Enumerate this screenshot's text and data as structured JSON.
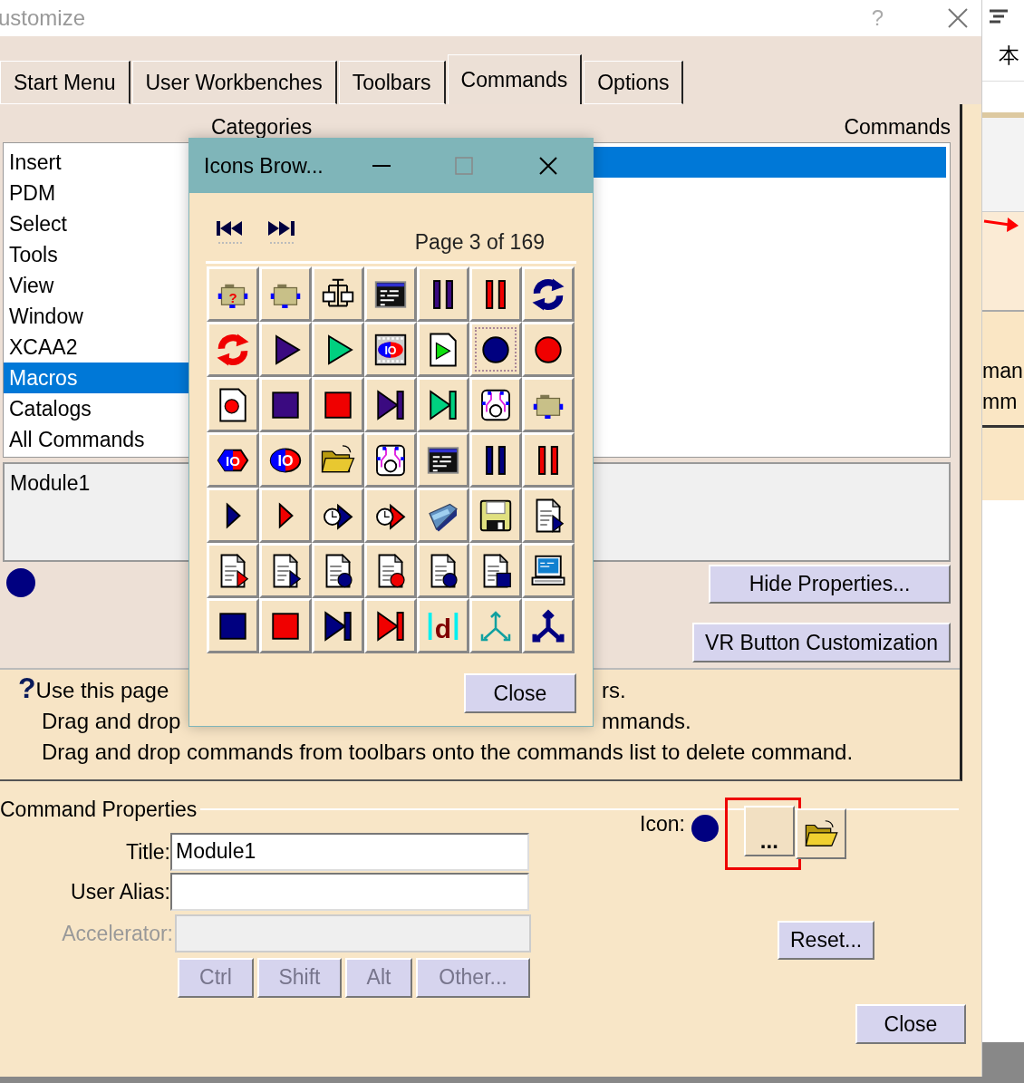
{
  "window": {
    "title": "ustomize",
    "help_button": "?"
  },
  "tabs": [
    {
      "label": "Start Menu",
      "selected": false
    },
    {
      "label": "User Workbenches",
      "selected": false
    },
    {
      "label": "Toolbars",
      "selected": false
    },
    {
      "label": "Commands",
      "selected": true
    },
    {
      "label": "Options",
      "selected": false
    }
  ],
  "categories": {
    "label": "Categories",
    "items": [
      {
        "label": "Insert",
        "selected": false
      },
      {
        "label": "PDM",
        "selected": false
      },
      {
        "label": "Select",
        "selected": false
      },
      {
        "label": "Tools",
        "selected": false
      },
      {
        "label": "View",
        "selected": false
      },
      {
        "label": "Window",
        "selected": false
      },
      {
        "label": "XCAA2",
        "selected": false
      },
      {
        "label": "Macros",
        "selected": true
      },
      {
        "label": "Catalogs",
        "selected": false
      },
      {
        "label": "All Commands",
        "selected": false
      }
    ]
  },
  "commands": {
    "label": "Commands",
    "rows": [
      {
        "selected": true
      }
    ]
  },
  "macros": {
    "items": [
      "Module1"
    ]
  },
  "buttons": {
    "hide_properties": "Hide Properties...",
    "vr_button": "VR Button Customization"
  },
  "help": {
    "mark": "?",
    "lines": [
      [
        "Use this page",
        "rs."
      ],
      [
        "Drag and drop",
        "mmands."
      ],
      [
        "Drag and drop commands from toolbars onto the commands list to delete command."
      ]
    ]
  },
  "command_properties": {
    "label": "Command Properties",
    "title": {
      "label": "Title:",
      "value": "Module1"
    },
    "user_alias": {
      "label": "User Alias:"
    },
    "accelerator": {
      "label": "Accelerator:",
      "disabled": true
    },
    "modifier_buttons": [
      {
        "label": "Ctrl",
        "disabled": true
      },
      {
        "label": "Shift",
        "disabled": true
      },
      {
        "label": "Alt",
        "disabled": true
      },
      {
        "label": "Other...",
        "disabled": true
      }
    ],
    "icon_label": "Icon:",
    "browse_button": {
      "label": "...",
      "highlighted": true
    },
    "reset_button": "Reset...",
    "close_button": "Close"
  },
  "icons_browser": {
    "title": "Icons Brow...",
    "page": "Page 3 of 169",
    "close_button": "Close",
    "icons": [
      {
        "selected": false,
        "text": "?"
      },
      {
        "selected": false
      },
      {
        "selected": false
      },
      {
        "selected": false
      },
      {
        "selected": false
      },
      {
        "selected": false
      },
      {
        "selected": false
      },
      {
        "selected": false
      },
      {
        "selected": false
      },
      {
        "selected": false
      },
      {
        "selected": false,
        "text": "IO"
      },
      {
        "selected": false
      },
      {
        "selected": true
      },
      {
        "selected": false
      },
      {
        "selected": false
      },
      {
        "selected": false
      },
      {
        "selected": false
      },
      {
        "selected": false
      },
      {
        "selected": false
      },
      {
        "selected": false
      },
      {
        "selected": false
      },
      {
        "selected": false,
        "text": "IO"
      },
      {
        "selected": false,
        "text": "IO"
      },
      {
        "selected": false
      },
      {
        "selected": false
      },
      {
        "selected": false
      },
      {
        "selected": false
      },
      {
        "selected": false
      },
      {
        "selected": false
      },
      {
        "selected": false
      },
      {
        "selected": false
      },
      {
        "selected": false
      },
      {
        "selected": false
      },
      {
        "selected": false
      },
      {
        "selected": false
      },
      {
        "selected": false
      },
      {
        "selected": false
      },
      {
        "selected": false
      },
      {
        "selected": false
      },
      {
        "selected": false
      },
      {
        "selected": false
      },
      {
        "selected": false
      },
      {
        "selected": false
      },
      {
        "selected": false
      },
      {
        "selected": false
      },
      {
        "selected": false
      },
      {
        "selected": false,
        "text": "d"
      },
      {
        "selected": false
      },
      {
        "selected": false
      }
    ]
  },
  "background_window": {
    "texts": [
      "本",
      "man",
      "mm"
    ]
  }
}
